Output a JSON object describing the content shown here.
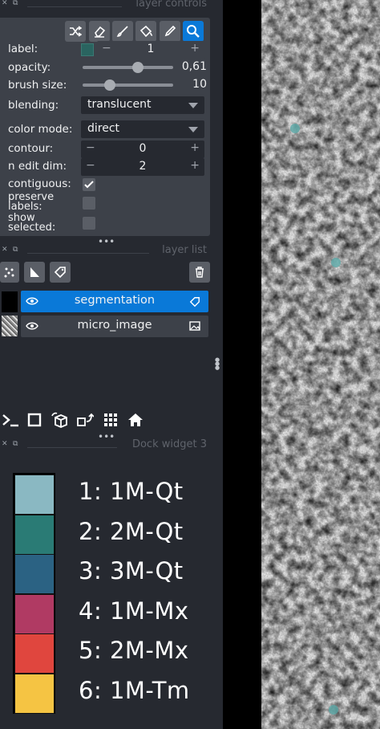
{
  "layer_controls": {
    "title": "layer controls",
    "tools": [
      "shuffle-icon",
      "eraser-icon",
      "brush-icon",
      "fill-icon",
      "picker-icon",
      "zoom-icon"
    ],
    "label": {
      "text": "label:",
      "value": "1",
      "minus": "−",
      "plus": "+"
    },
    "opacity": {
      "text": "opacity:",
      "value": "0,61",
      "fraction": 0.61
    },
    "brush_size": {
      "text": "brush size:",
      "value": "10",
      "fraction": 0.3
    },
    "blending": {
      "text": "blending:",
      "value": "translucent"
    },
    "color_mode": {
      "text": "color mode:",
      "value": "direct"
    },
    "contour": {
      "text": "contour:",
      "value": "0",
      "minus": "−",
      "plus": "+"
    },
    "n_edit_dim": {
      "text": "n edit dim:",
      "value": "2",
      "minus": "−",
      "plus": "+"
    },
    "contiguous": {
      "text": "contiguous:",
      "checked": true
    },
    "preserve_labels": {
      "text1": "preserve",
      "text2": "labels:",
      "checked": false
    },
    "show_selected": {
      "text1": "show",
      "text2": "selected:",
      "checked": false
    }
  },
  "layer_list": {
    "title": "layer list",
    "layers": [
      {
        "name": "segmentation",
        "selected": true
      },
      {
        "name": "micro_image",
        "selected": false
      }
    ]
  },
  "dock_widget": {
    "title": "Dock widget 3",
    "legend": [
      {
        "label": "1: 1M-Qt",
        "color": "#8ab8c2"
      },
      {
        "label": "2: 2M-Qt",
        "color": "#2a7b75"
      },
      {
        "label": "3: 3M-Qt",
        "color": "#2b6283"
      },
      {
        "label": "4: 1M-Mx",
        "color": "#b03a63"
      },
      {
        "label": "5: 2M-Mx",
        "color": "#e0463e"
      },
      {
        "label": "6: 1M-Tm",
        "color": "#f5c443"
      }
    ]
  },
  "colors": {
    "accent": "#0a79d8",
    "panel": "#3d4149",
    "background": "#262930"
  }
}
